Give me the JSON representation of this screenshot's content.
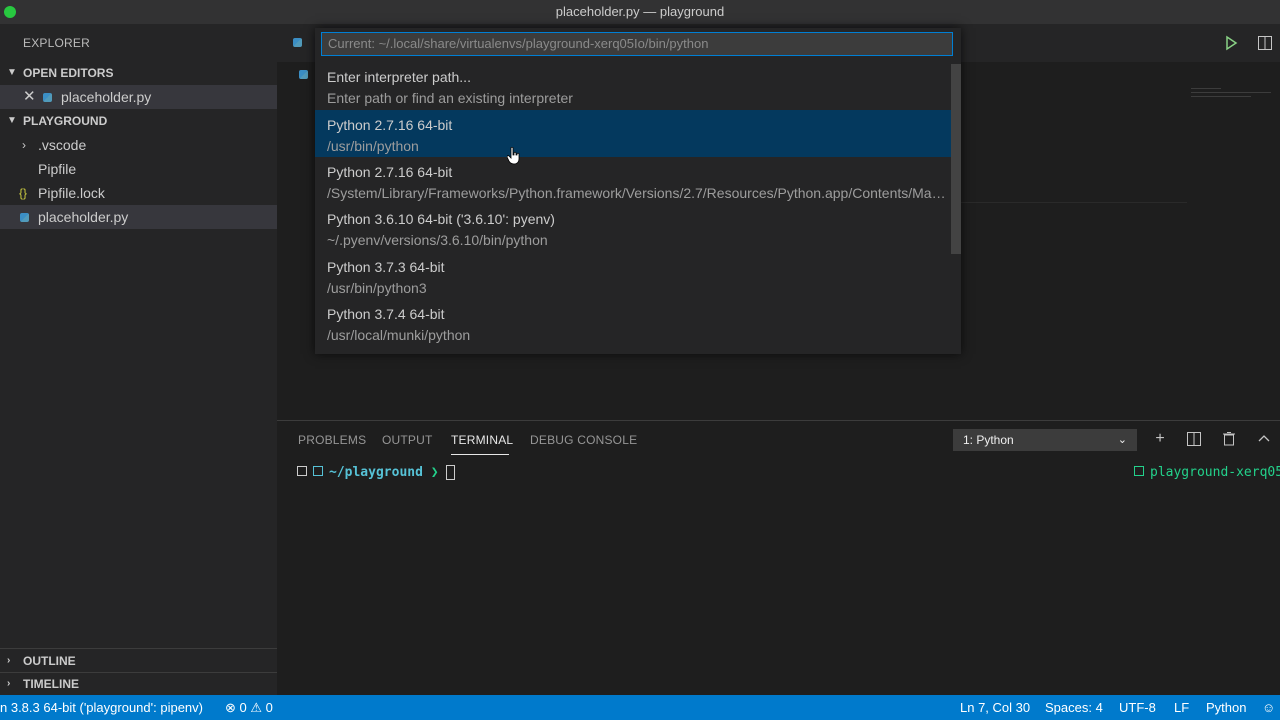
{
  "window": {
    "title": "placeholder.py — playground"
  },
  "sidebar": {
    "title": "EXPLORER",
    "open_editors": {
      "label": "OPEN EDITORS",
      "items": [
        {
          "label": "placeholder.py"
        }
      ]
    },
    "workspace": {
      "label": "PLAYGROUND",
      "items": [
        {
          "label": ".vscode",
          "type": "folder"
        },
        {
          "label": "Pipfile",
          "type": "file"
        },
        {
          "label": "Pipfile.lock",
          "type": "json"
        },
        {
          "label": "placeholder.py",
          "type": "python",
          "selected": true
        }
      ]
    },
    "outline": "OUTLINE",
    "timeline": "TIMELINE"
  },
  "quick_pick": {
    "placeholder": "Current: ~/.local/share/virtualenvs/playground-xerq05Io/bin/python",
    "items": [
      {
        "label": "Enter interpreter path...",
        "description": "Enter path or find an existing interpreter"
      },
      {
        "label": "Python 2.7.16 64-bit",
        "description": "/usr/bin/python",
        "active": true
      },
      {
        "label": "Python 2.7.16 64-bit",
        "description": "/System/Library/Frameworks/Python.framework/Versions/2.7/Resources/Python.app/Contents/Mac..."
      },
      {
        "label": "Python 3.6.10 64-bit ('3.6.10': pyenv)",
        "description": "~/.pyenv/versions/3.6.10/bin/python"
      },
      {
        "label": "Python 3.7.3 64-bit",
        "description": "/usr/bin/python3"
      },
      {
        "label": "Python 3.7.4 64-bit",
        "description": "/usr/local/munki/python"
      }
    ]
  },
  "panel": {
    "tabs": [
      "PROBLEMS",
      "OUTPUT",
      "TERMINAL",
      "DEBUG CONSOLE"
    ],
    "active_tab": "TERMINAL",
    "terminal_select": "1: Python",
    "terminal": {
      "path": "~/playground",
      "prompt": "❯",
      "right_info": "playground-xerq05"
    }
  },
  "statusbar": {
    "interpreter": "n 3.8.3 64-bit ('playground': pipenv)",
    "errors": "0",
    "warnings": "0",
    "position": "Ln 7, Col 30",
    "spaces": "Spaces: 4",
    "encoding": "UTF-8",
    "eol": "LF",
    "language": "Python"
  },
  "colors": {
    "accent": "#007acc",
    "selection": "#04395e",
    "terminal_green": "#23d18b"
  }
}
